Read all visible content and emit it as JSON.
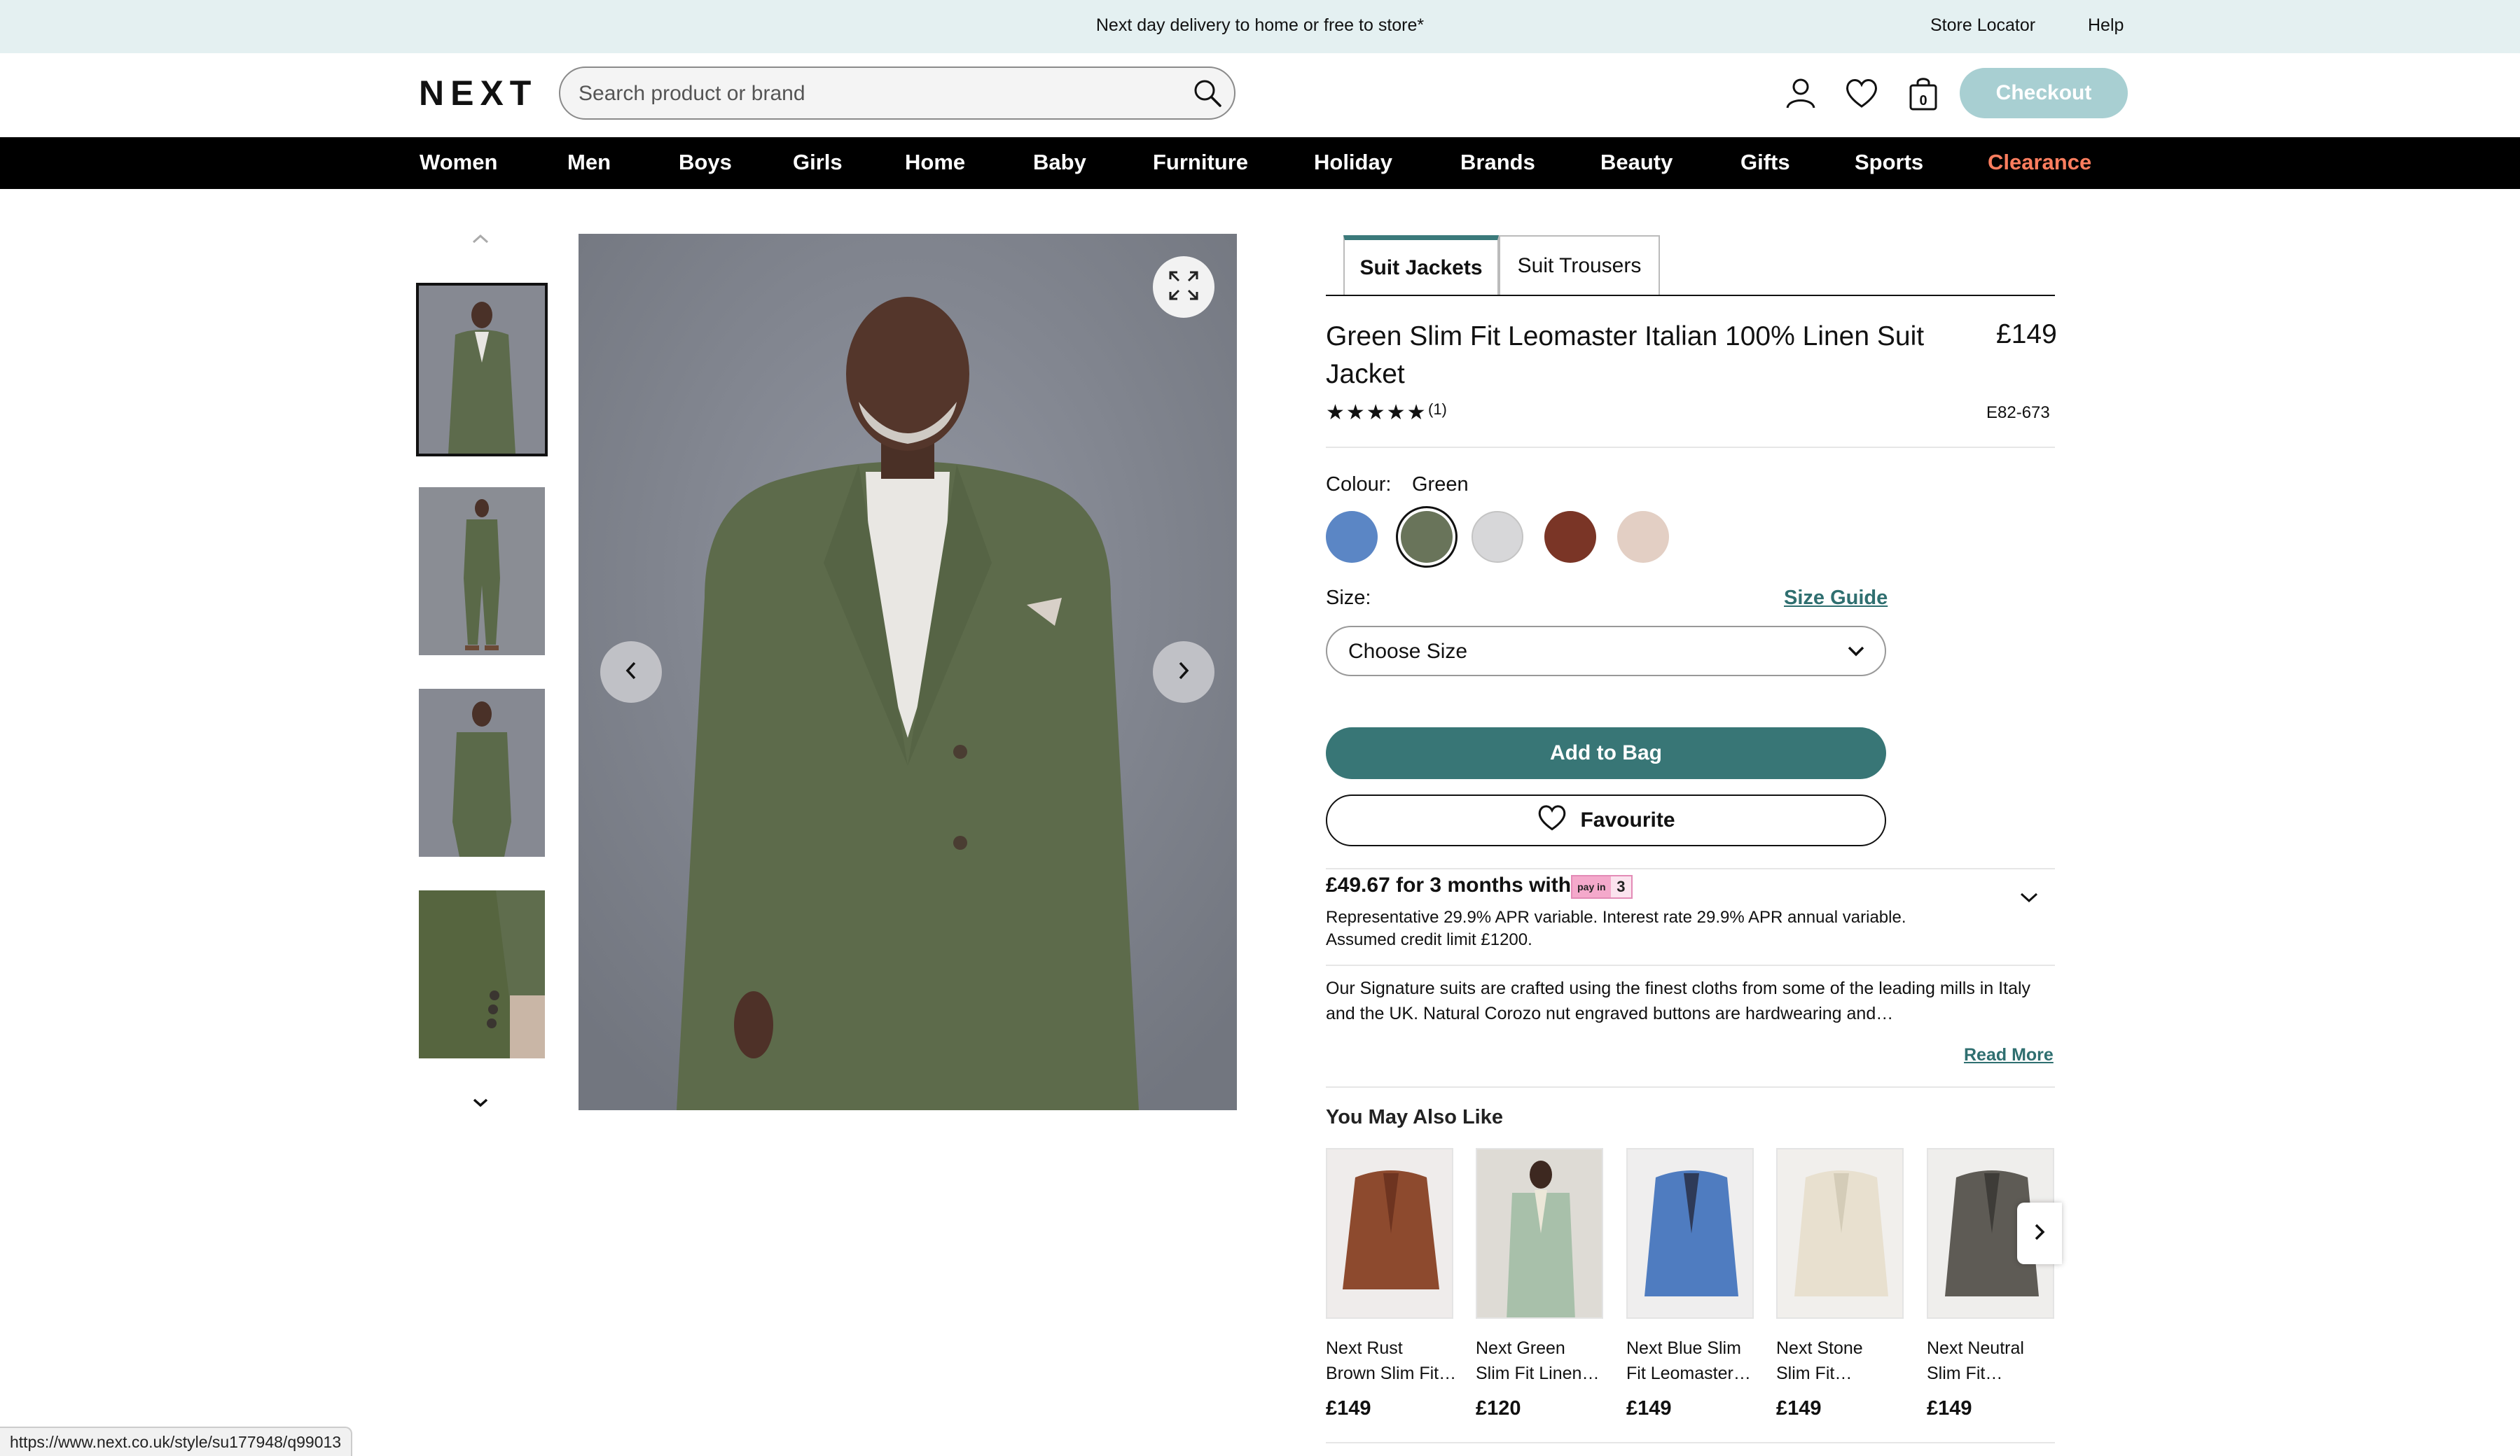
{
  "banner": {
    "text": "Next day delivery to home or free to store*",
    "store_locator": "Store Locator",
    "help": "Help"
  },
  "header": {
    "logo": "NEXT",
    "search_placeholder": "Search product or brand",
    "bag_count": "0",
    "checkout_label": "Checkout"
  },
  "nav": {
    "items": [
      "Women",
      "Men",
      "Boys",
      "Girls",
      "Home",
      "Baby",
      "Furniture",
      "Holiday",
      "Brands",
      "Beauty",
      "Gifts",
      "Sports",
      "Clearance"
    ]
  },
  "gallery": {
    "thumbnails": [
      "front-view",
      "full-length-view",
      "back-view",
      "sleeve-detail"
    ],
    "selected_index": 0
  },
  "product": {
    "tabs": [
      "Suit Jackets",
      "Suit Trousers"
    ],
    "active_tab": "Suit Jackets",
    "title": "Green Slim Fit Leomaster Italian 100% Linen Suit Jacket",
    "price": "£149",
    "rating_stars": "★★★★★",
    "rating_count": "(1)",
    "item_code": "E82-673",
    "colour_label": "Colour:",
    "colour_value": "Green",
    "swatches": [
      {
        "name": "Blue",
        "color": "#5b86c5"
      },
      {
        "name": "Green",
        "color": "#69745a"
      },
      {
        "name": "Light Grey",
        "color": "#d7d7d9"
      },
      {
        "name": "Rust",
        "color": "#7a3526"
      },
      {
        "name": "Stone",
        "color": "#e3cfc4"
      }
    ],
    "size_label": "Size:",
    "size_guide": "Size Guide",
    "size_select": "Choose Size",
    "add_to_bag": "Add to Bag",
    "favourite": "Favourite"
  },
  "credit": {
    "title": "£49.67 for 3 months with",
    "badge_left": "pay in",
    "badge_right": "3",
    "line1": "Representative 29.9% APR variable. Interest rate 29.9% APR annual variable.",
    "line2": "Assumed credit limit £1200."
  },
  "description": {
    "text": "Our Signature suits are crafted using the finest cloths from some of the leading mills in Italy and the UK. Natural Corozo nut engraved buttons are hardwearing and…",
    "read_more": "Read More"
  },
  "recommendations": {
    "title": "You May Also Like",
    "items": [
      {
        "line1": "Next Rust",
        "line2": "Brown Slim Fit…",
        "price": "£149",
        "color": "#8d4a2e"
      },
      {
        "line1": "Next Green",
        "line2": "Slim Fit Linen…",
        "price": "£120",
        "color": "#a8c0aa"
      },
      {
        "line1": "Next Blue Slim",
        "line2": "Fit Leomaster…",
        "price": "£149",
        "color": "#4f7cc0"
      },
      {
        "line1": "Next Stone",
        "line2": "Slim Fit…",
        "price": "£149",
        "color": "#e8e0cf"
      },
      {
        "line1": "Next Neutral",
        "line2": "Slim Fit…",
        "price": "£149",
        "color": "#5e5b55"
      }
    ]
  },
  "status_bar": {
    "url": "https://www.next.co.uk/style/su177948/q99013"
  }
}
